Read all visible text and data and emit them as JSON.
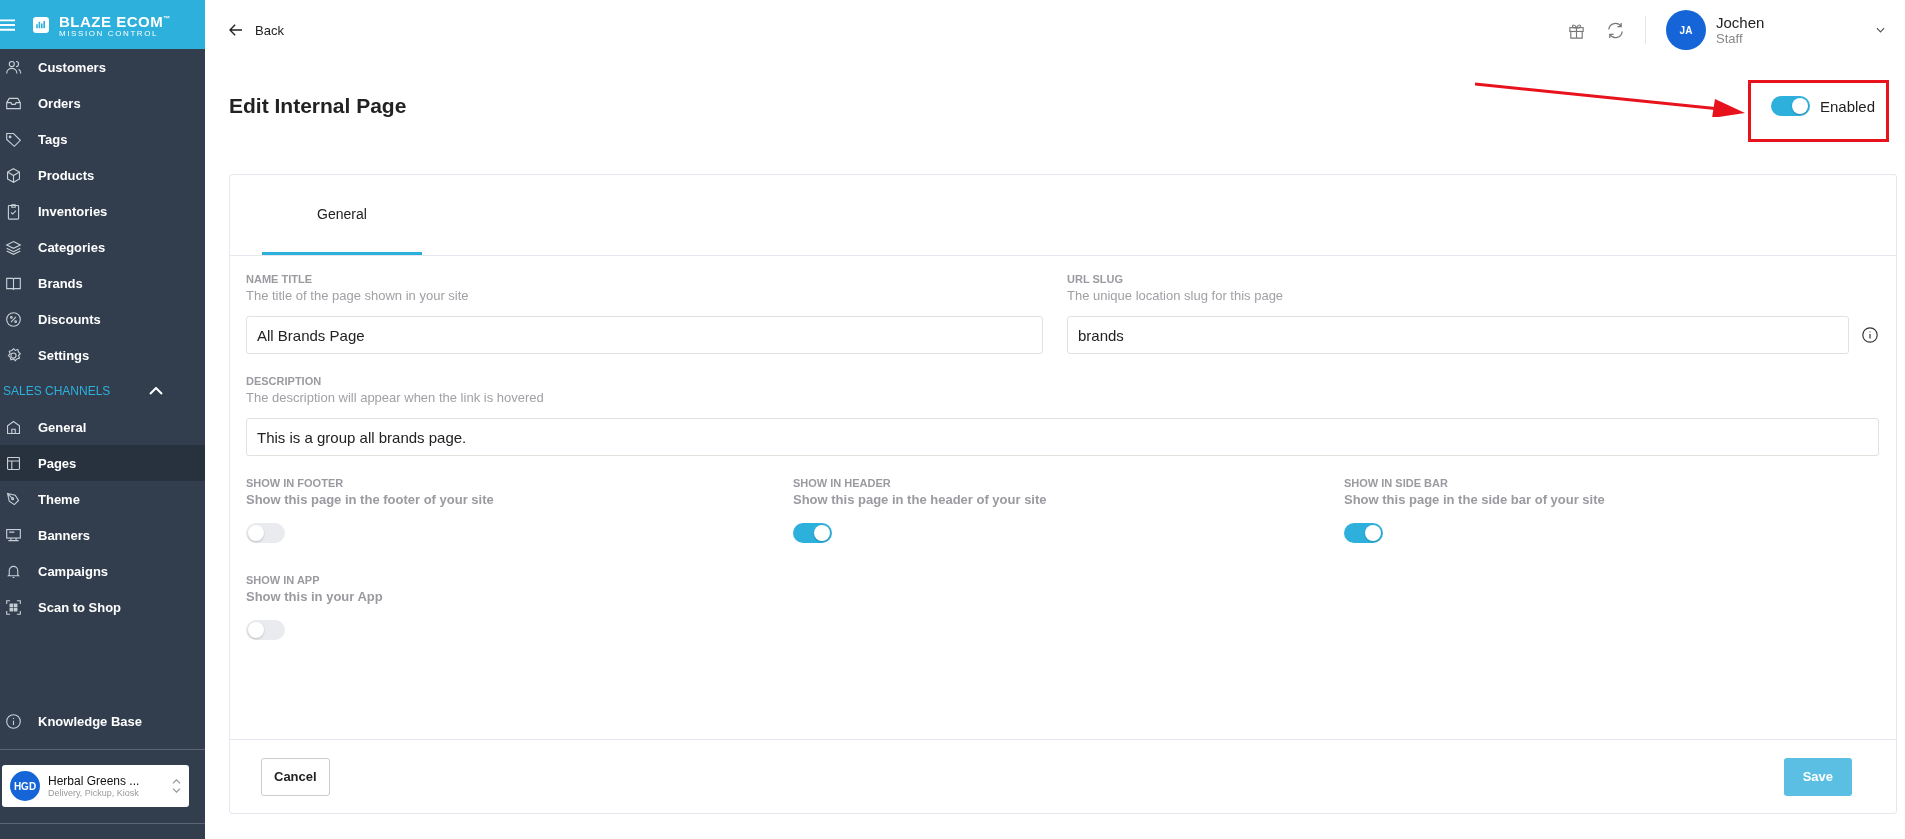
{
  "sidebar": {
    "logo": {
      "title": "BLAZE ECOM",
      "trademark": "™",
      "subtitle": "MISSION CONTROL"
    },
    "items": [
      {
        "label": "Customers",
        "selected": false
      },
      {
        "label": "Orders",
        "selected": false
      },
      {
        "label": "Tags",
        "selected": false
      },
      {
        "label": "Products",
        "selected": false
      },
      {
        "label": "Inventories",
        "selected": false
      },
      {
        "label": "Categories",
        "selected": false
      },
      {
        "label": "Brands",
        "selected": false
      },
      {
        "label": "Discounts",
        "selected": false
      },
      {
        "label": "Settings",
        "selected": false
      }
    ],
    "section": {
      "title": "SALES CHANNELS",
      "expanded": true,
      "items": [
        {
          "label": "General",
          "selected": false
        },
        {
          "label": "Pages",
          "selected": true
        },
        {
          "label": "Theme",
          "selected": false
        },
        {
          "label": "Banners",
          "selected": false
        },
        {
          "label": "Campaigns",
          "selected": false
        },
        {
          "label": "Scan to Shop",
          "selected": false
        }
      ]
    },
    "footer_items": [
      {
        "label": "Knowledge Base"
      }
    ],
    "store": {
      "initials": "HGD",
      "name": "Herbal Greens ...",
      "channels": "Delivery, Pickup, Kiosk"
    }
  },
  "header": {
    "back": "Back",
    "user": {
      "initials": "JA",
      "name": "Jochen",
      "role": "Staff"
    }
  },
  "page": {
    "title": "Edit Internal Page",
    "status": {
      "label": "Enabled",
      "on": true
    }
  },
  "tabs": [
    {
      "label": "General",
      "selected": true
    }
  ],
  "fields": [
    {
      "label": "NAME TITLE",
      "hint": "The title of the page shown in your site",
      "value": "All Brands Page",
      "info": false
    },
    {
      "label": "URL SLUG",
      "hint": "The unique location slug for this page",
      "value": "brands",
      "info": true
    },
    {
      "label": "DESCRIPTION",
      "hint": "The description will appear when the link is hovered",
      "value": "This is a group all brands page.",
      "info": false
    }
  ],
  "toggles": [
    {
      "label": "SHOW IN FOOTER",
      "hint": "Show this page in the footer of your site",
      "on": false
    },
    {
      "label": "SHOW IN HEADER",
      "hint": "Show this page in the header of your site",
      "on": true
    },
    {
      "label": "SHOW IN SIDE BAR",
      "hint": "Show this page in the side bar of your site",
      "on": true
    },
    {
      "label": "SHOW IN APP",
      "hint": "Show this in your App",
      "on": false
    }
  ],
  "buttons": {
    "cancel": "Cancel",
    "save": {
      "label": "Save",
      "disabled": true
    }
  }
}
